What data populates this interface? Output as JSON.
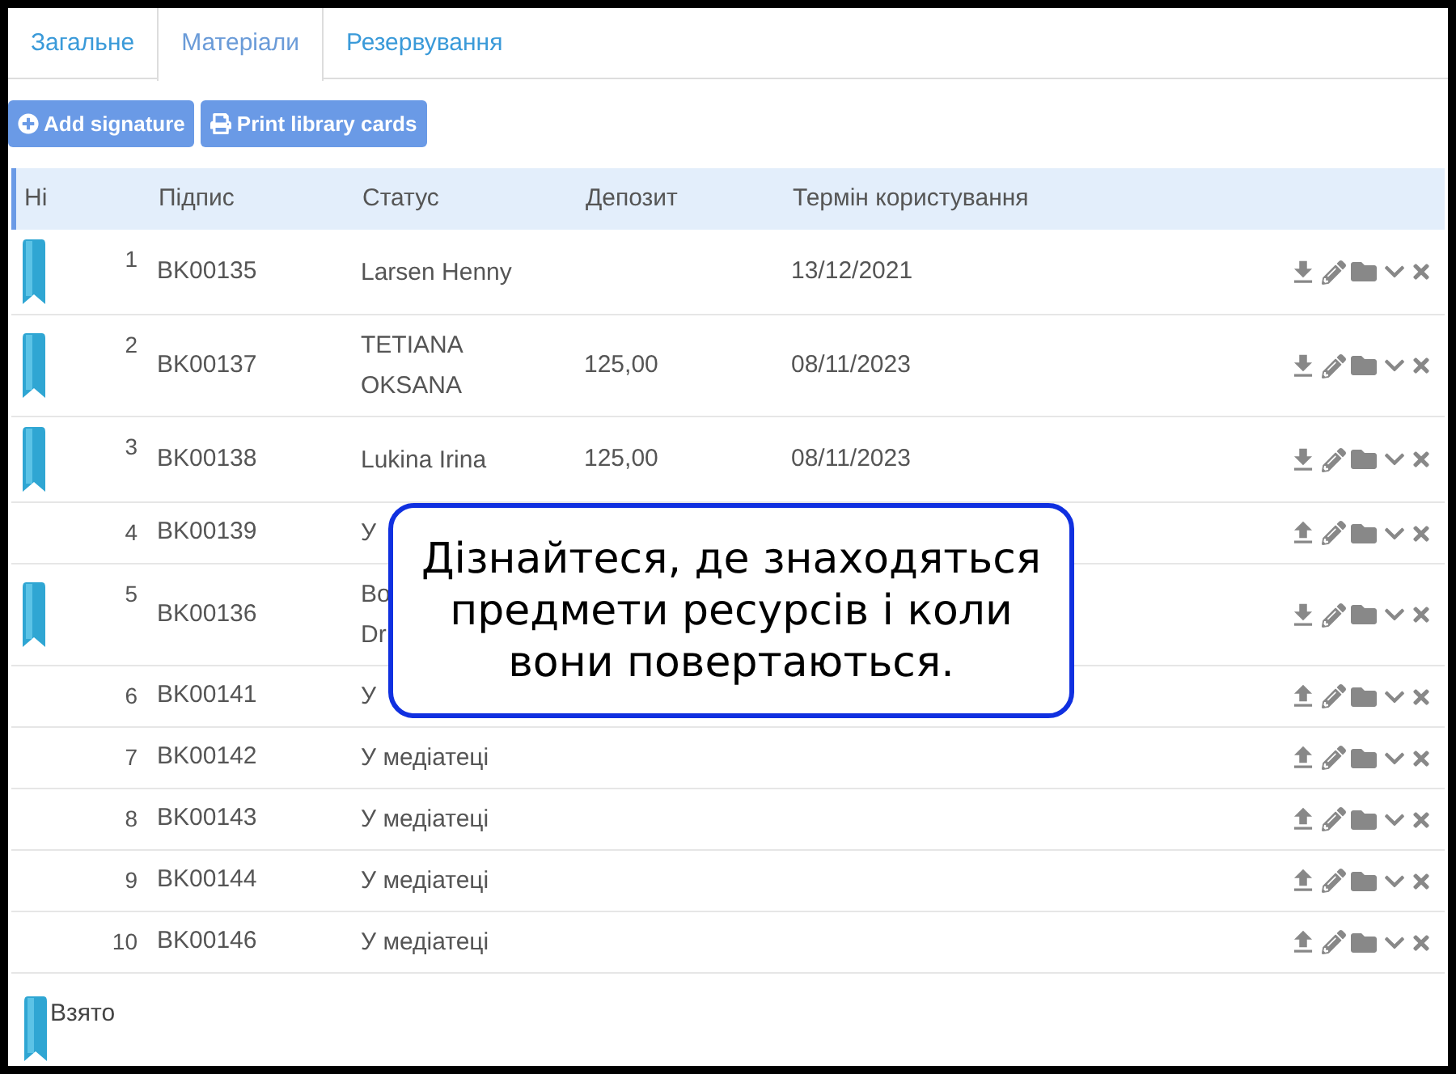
{
  "tabs": [
    {
      "label": "Загальне",
      "selected": false
    },
    {
      "label": "Матеріали",
      "selected": true
    },
    {
      "label": "Резервування",
      "selected": false
    }
  ],
  "buttons": [
    {
      "kind": "add",
      "label": "Add signature"
    },
    {
      "kind": "print",
      "label": "Print library cards"
    }
  ],
  "table": {
    "columns": [
      "Ні",
      "Підпис",
      "Статус",
      "Депозит",
      "Термін користування"
    ],
    "rows": [
      {
        "number": "1",
        "signature": "BK00135",
        "status": [
          "Larsen Henny"
        ],
        "deposit": "",
        "term": "13/12/2021",
        "borrowed": true
      },
      {
        "number": "2",
        "signature": "BK00137",
        "status": [
          "TETIANA",
          "OKSANA"
        ],
        "deposit": "125,00",
        "term": "08/11/2023",
        "borrowed": true
      },
      {
        "number": "3",
        "signature": "BK00138",
        "status": [
          "Lukina Irina"
        ],
        "deposit": "125,00",
        "term": "08/11/2023",
        "borrowed": true
      },
      {
        "number": "4",
        "signature": "BK00139",
        "status": [
          "У"
        ],
        "deposit": "",
        "term": "",
        "borrowed": false
      },
      {
        "number": "5",
        "signature": "BK00136",
        "status": [
          "Bo",
          "Dr"
        ],
        "deposit": "",
        "term": "",
        "borrowed": true
      },
      {
        "number": "6",
        "signature": "BK00141",
        "status": [
          "У"
        ],
        "deposit": "",
        "term": "",
        "borrowed": false
      },
      {
        "number": "7",
        "signature": "BK00142",
        "status": [
          "У медіатеці"
        ],
        "deposit": "",
        "term": "",
        "borrowed": false
      },
      {
        "number": "8",
        "signature": "BK00143",
        "status": [
          "У медіатеці"
        ],
        "deposit": "",
        "term": "",
        "borrowed": false
      },
      {
        "number": "9",
        "signature": "BK00144",
        "status": [
          "У медіатеці"
        ],
        "deposit": "",
        "term": "",
        "borrowed": false
      },
      {
        "number": "10",
        "signature": "BK00146",
        "status": [
          "У медіатеці"
        ],
        "deposit": "",
        "term": "",
        "borrowed": false
      }
    ]
  },
  "legend": {
    "label": "Взято"
  },
  "callout": {
    "text": "Дізнайтеся, де знаходяться предмети ресурсів і коли вони повертаються."
  }
}
